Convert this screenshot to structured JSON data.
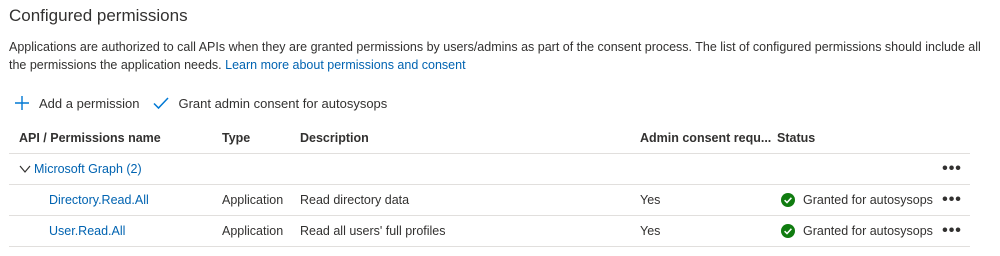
{
  "page": {
    "title": "Configured permissions",
    "description": "Applications are authorized to call APIs when they are granted permissions by users/admins as part of the consent process. The list of configured permissions should include all the permissions the application needs.",
    "learn_more_link": "Learn more about permissions and consent"
  },
  "toolbar": {
    "add_permission_label": "Add a permission",
    "grant_consent_label": "Grant admin consent for autosysops"
  },
  "table": {
    "headers": {
      "name": "API / Permissions name",
      "type": "Type",
      "description": "Description",
      "admin_consent": "Admin consent requ...",
      "status": "Status"
    },
    "group": {
      "label": "Microsoft Graph (2)",
      "more": "•••"
    },
    "rows": [
      {
        "name": "Directory.Read.All",
        "type": "Application",
        "description": "Read directory data",
        "admin_consent": "Yes",
        "status": "Granted for autosysops",
        "more": "•••"
      },
      {
        "name": "User.Read.All",
        "type": "Application",
        "description": "Read all users' full profiles",
        "admin_consent": "Yes",
        "status": "Granted for autosysops",
        "more": "•••"
      }
    ]
  },
  "colors": {
    "link": "#0063b1",
    "granted": "#107c10",
    "border": "#e1dfdd"
  }
}
